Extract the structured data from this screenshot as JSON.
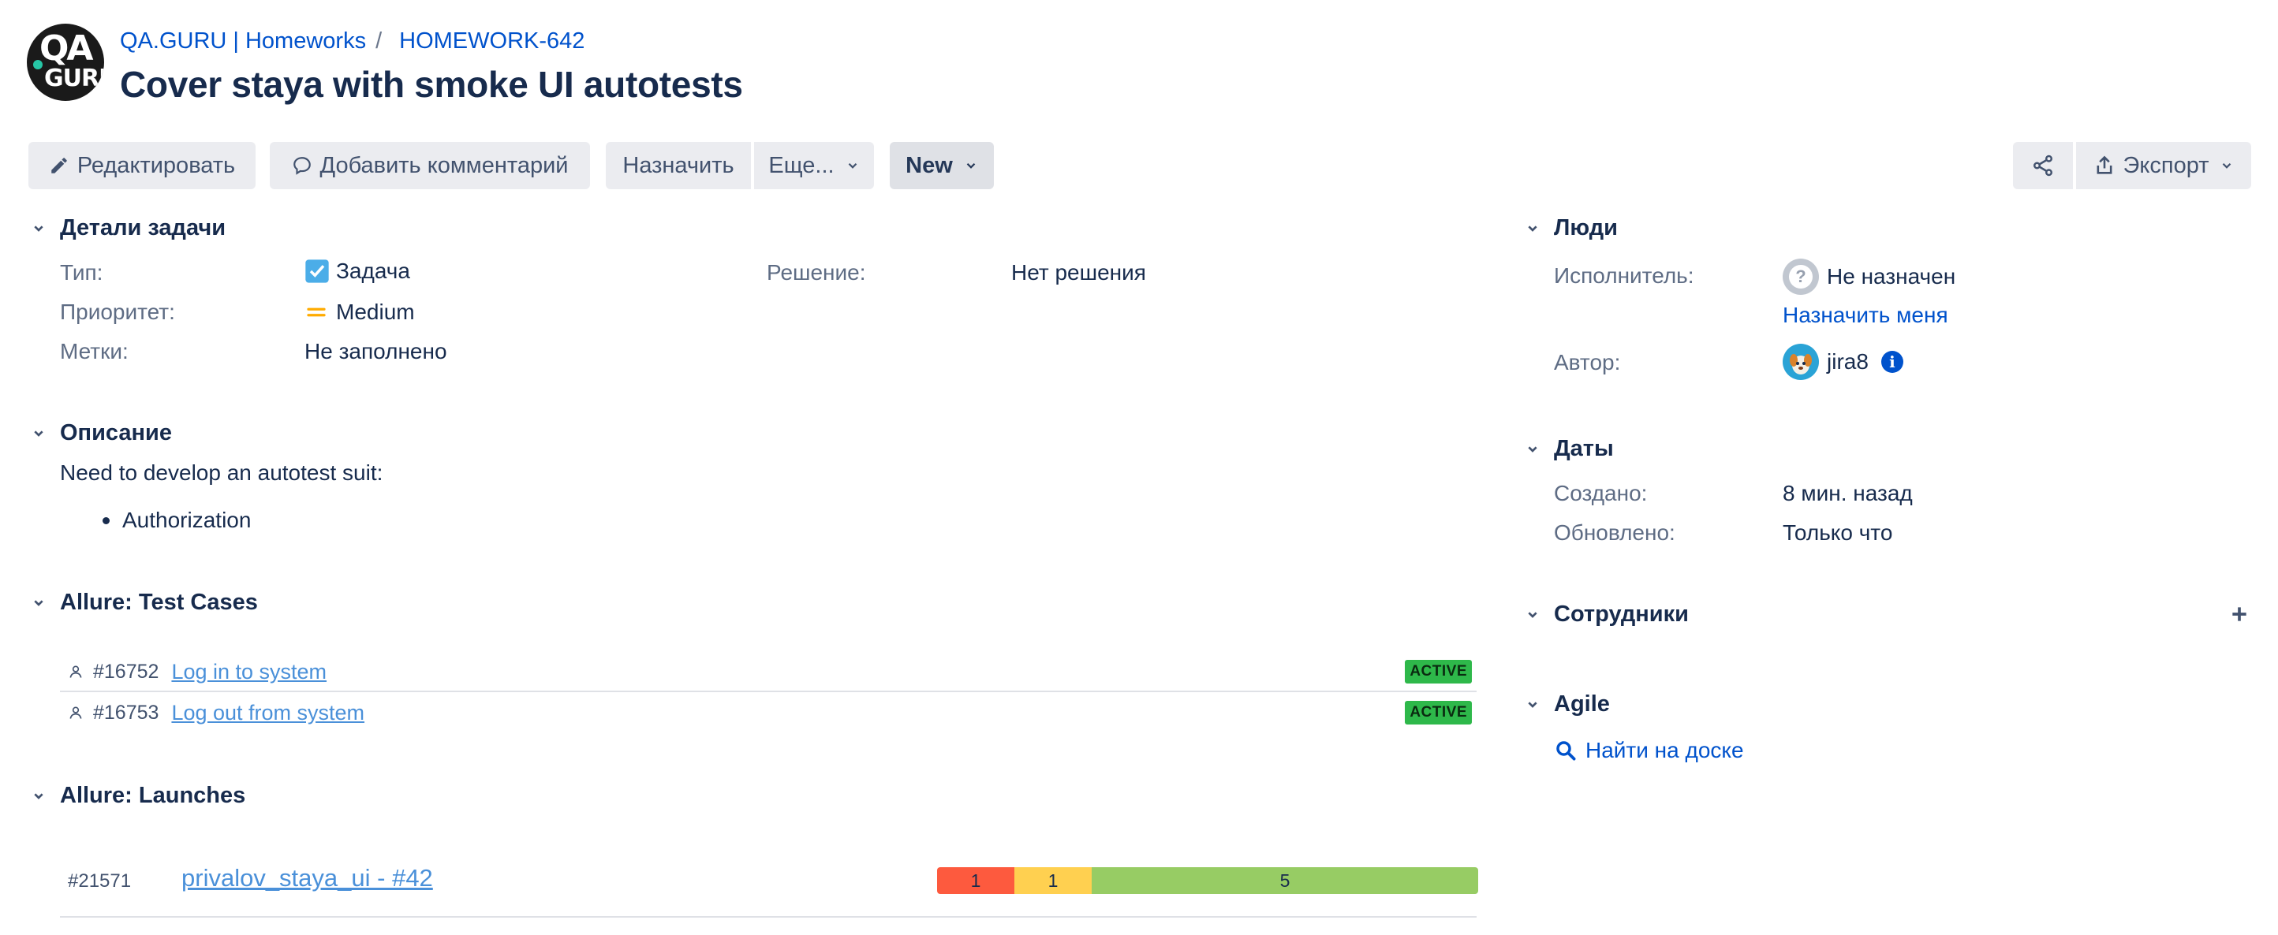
{
  "header": {
    "logo_text_top": "QA",
    "logo_text_bottom": "GURU",
    "breadcrumb": {
      "project": "QA.GURU | Homeworks",
      "separator": "/",
      "issue_key": "HOMEWORK-642"
    },
    "title": "Cover staya with smoke UI autotests"
  },
  "toolbar": {
    "edit_label": "Редактировать",
    "comment_label": "Добавить комментарий",
    "assign_label": "Назначить",
    "more_label": "Еще...",
    "status_label": "New",
    "export_label": "Экспорт"
  },
  "details": {
    "title": "Детали задачи",
    "type_label": "Тип:",
    "type_value": "Задача",
    "priority_label": "Приоритет:",
    "priority_value": "Medium",
    "labels_label": "Метки:",
    "labels_value": "Не заполнено",
    "resolution_label": "Решение:",
    "resolution_value": "Нет решения"
  },
  "description": {
    "title": "Описание",
    "text": "Need to develop an autotest suit:",
    "items": [
      "Authorization"
    ]
  },
  "test_cases": {
    "title": "Allure: Test Cases",
    "rows": [
      {
        "id": "#16752",
        "name": "Log in to system",
        "status": "ACTIVE"
      },
      {
        "id": "#16753",
        "name": "Log out from system",
        "status": "ACTIVE"
      }
    ]
  },
  "launches": {
    "title": "Allure: Launches",
    "rows": [
      {
        "id": "#21571",
        "name": "privalov_staya_ui - #42",
        "failed": 1,
        "broken": 1,
        "passed": 5
      }
    ],
    "colors": {
      "failed": "#fd5a3e",
      "broken": "#ffd050",
      "passed": "#97cc64"
    }
  },
  "people": {
    "title": "Люди",
    "assignee_label": "Исполнитель:",
    "assignee_value": "Не назначен",
    "assign_me": "Назначить меня",
    "reporter_label": "Автор:",
    "reporter_value": "jira8"
  },
  "dates": {
    "title": "Даты",
    "created_label": "Создано:",
    "created_value": "8 мин. назад",
    "updated_label": "Обновлено:",
    "updated_value": "Только что"
  },
  "staff": {
    "title": "Сотрудники"
  },
  "agile": {
    "title": "Agile",
    "find_on_board": "Найти на доске"
  }
}
